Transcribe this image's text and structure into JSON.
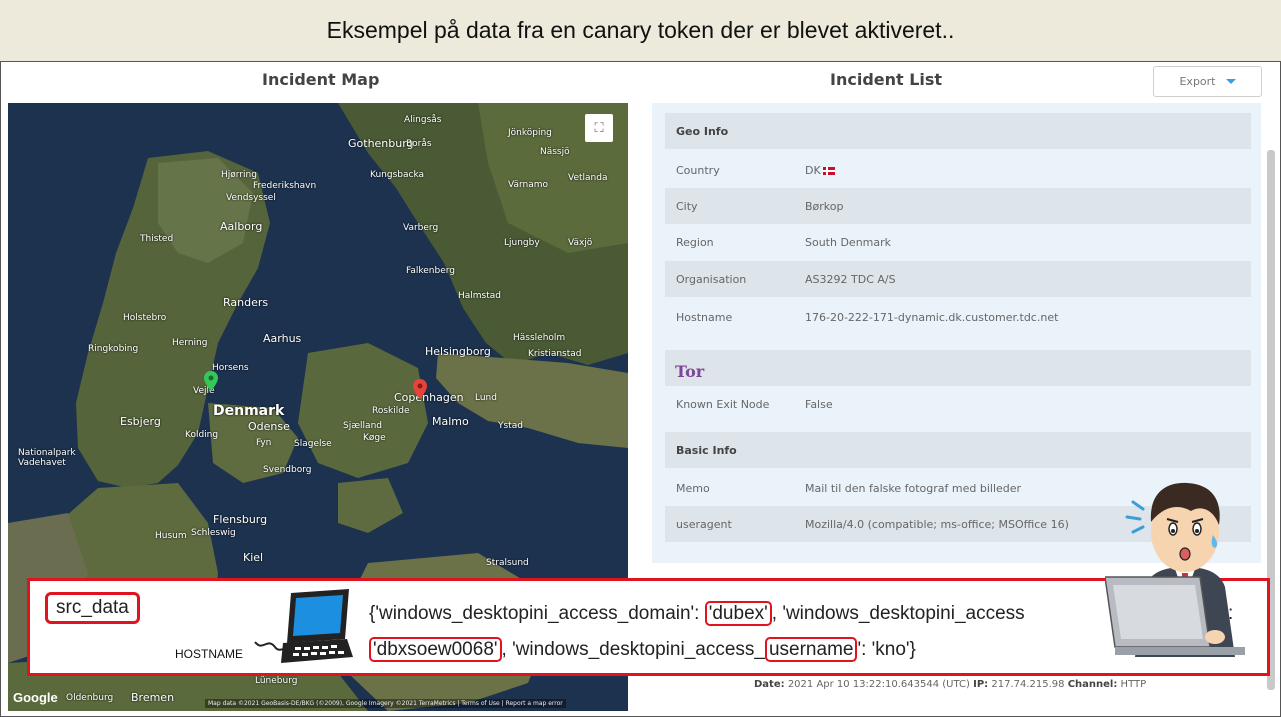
{
  "banner": {
    "text": "Eksempel på data fra en canary token der er blevet aktiveret.."
  },
  "map": {
    "title": "Incident Map",
    "labels": [
      {
        "text": "Gothenburg",
        "size": "mid"
      },
      {
        "text": "Borås",
        "size": "small"
      },
      {
        "text": "Jönköping",
        "size": "small"
      },
      {
        "text": "Alingsås",
        "size": "small"
      },
      {
        "text": "Nässjö",
        "size": "small"
      },
      {
        "text": "Kungsbacka",
        "size": "small"
      },
      {
        "text": "Hjørring",
        "size": "small"
      },
      {
        "text": "Frederikshavn",
        "size": "small"
      },
      {
        "text": "Vendsyssel",
        "size": "small"
      },
      {
        "text": "Varberg",
        "size": "small"
      },
      {
        "text": "Värnamo",
        "size": "small"
      },
      {
        "text": "Vetlanda",
        "size": "small"
      },
      {
        "text": "Aalborg",
        "size": "mid"
      },
      {
        "text": "Thisted",
        "size": "small"
      },
      {
        "text": "Falkenberg",
        "size": "small"
      },
      {
        "text": "Ljungby",
        "size": "small"
      },
      {
        "text": "Växjö",
        "size": "small"
      },
      {
        "text": "Halmstad",
        "size": "small"
      },
      {
        "text": "Randers",
        "size": "mid"
      },
      {
        "text": "Holstebro",
        "size": "small"
      },
      {
        "text": "Aarhus",
        "size": "mid"
      },
      {
        "text": "Hässleholm",
        "size": "small"
      },
      {
        "text": "Ringkobing",
        "size": "small"
      },
      {
        "text": "Herning",
        "size": "small"
      },
      {
        "text": "Helsingborg",
        "size": "mid"
      },
      {
        "text": "Kristianstad",
        "size": "small"
      },
      {
        "text": "Horsens",
        "size": "small"
      },
      {
        "text": "Vejle",
        "size": "small"
      },
      {
        "text": "Copenhagen",
        "size": "mid"
      },
      {
        "text": "Lund",
        "size": "small"
      },
      {
        "text": "Esbjerg",
        "size": "mid"
      },
      {
        "text": "Denmark",
        "size": "big"
      },
      {
        "text": "Roskilde",
        "size": "small"
      },
      {
        "text": "Malmo",
        "size": "mid"
      },
      {
        "text": "Ystad",
        "size": "small"
      },
      {
        "text": "Kolding",
        "size": "small"
      },
      {
        "text": "Odense",
        "size": "mid"
      },
      {
        "text": "Sjælland",
        "size": "small"
      },
      {
        "text": "Køge",
        "size": "small"
      },
      {
        "text": "Fyn",
        "size": "small"
      },
      {
        "text": "Slagelse",
        "size": "small"
      },
      {
        "text": "Nationalpark Vadehavet",
        "size": "small"
      },
      {
        "text": "Svendborg",
        "size": "small"
      },
      {
        "text": "Flensburg",
        "size": "mid"
      },
      {
        "text": "Husum",
        "size": "small"
      },
      {
        "text": "Schleswig",
        "size": "small"
      },
      {
        "text": "Kiel",
        "size": "mid"
      },
      {
        "text": "Stralsund",
        "size": "small"
      },
      {
        "text": "Oldenburg",
        "size": "small"
      },
      {
        "text": "Bremen",
        "size": "mid"
      },
      {
        "text": "Lüneburg",
        "size": "small"
      }
    ],
    "google_logo": "Google",
    "footer": "Map data ©2021 GeoBasis-DE/BKG (©2009), Google Imagery ©2021 TerraMetrics | Terms of Use | Report a map error"
  },
  "list": {
    "title": "Incident List",
    "export_label": "Export",
    "geo_section": "Geo Info",
    "geo_rows": [
      {
        "key": "Country",
        "value": "DK"
      },
      {
        "key": "City",
        "value": "Børkop"
      },
      {
        "key": "Region",
        "value": "South Denmark"
      },
      {
        "key": "Organisation",
        "value": "AS3292 TDC A/S"
      },
      {
        "key": "Hostname",
        "value": "176-20-222-171-dynamic.dk.customer.tdc.net"
      }
    ],
    "tor_logo": "Tor",
    "tor_rows": [
      {
        "key": "Known Exit Node",
        "value": "False"
      }
    ],
    "basic_section": "Basic Info",
    "basic_rows": [
      {
        "key": "Memo",
        "value": "Mail til den falske fotograf med billeder"
      },
      {
        "key": "useragent",
        "value": "Mozilla/4.0 (compatible; ms-office; MSOffice 16)"
      }
    ],
    "footer": {
      "date_label": "Date:",
      "date_value": "2021 Apr 10 13:22:10.643544 (UTC)",
      "ip_label": "IP:",
      "ip_value": "217.74.215.98",
      "channel_label": "Channel:",
      "channel_value": "HTTP"
    }
  },
  "overlay": {
    "src_label": "src_data",
    "hostname_label": "HOSTNAME",
    "line1_a": "{'windows_desktopini_access_domain': ",
    "line1_hl": "'dubex'",
    "line1_b": ", 'windows_desktopini_access",
    "line1_end": ":",
    "line2_hl1": "'dbxsoew0068'",
    "line2_a": ", 'windows_desktopini_access_",
    "line2_hl2": "username",
    "line2_b": "': 'kno'}"
  },
  "colors": {
    "accent_red": "#e0141e",
    "banner_bg": "#ede9db",
    "panel_bg": "#eaf3fa",
    "row_shade": "#dde4ea"
  }
}
